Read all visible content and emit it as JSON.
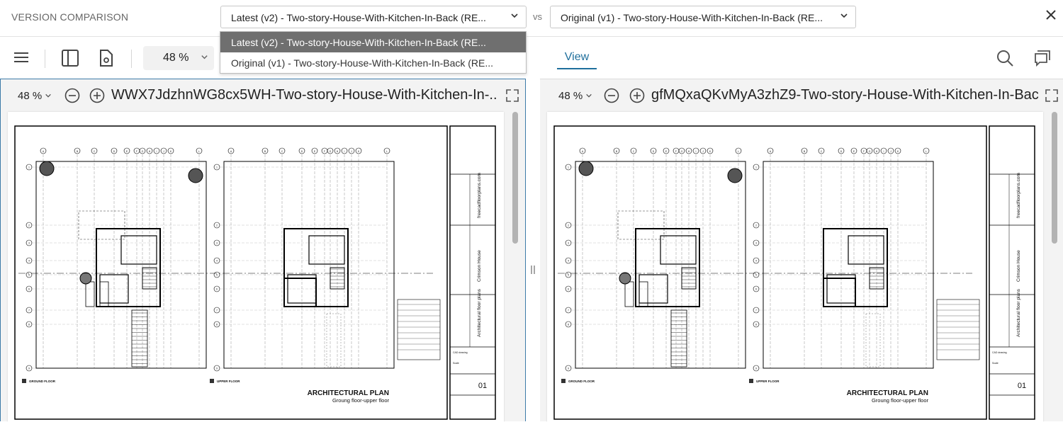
{
  "header": {
    "title": "VERSION COMPARISON",
    "left_version": "Latest (v2) - Two-story-House-With-Kitchen-In-Back (RE...",
    "vs_label": "vs",
    "right_version": "Original (v1) - Two-story-House-With-Kitchen-In-Back (RE...",
    "close_icon": "close-icon"
  },
  "dropdown": {
    "options": [
      "Latest (v2) - Two-story-House-With-Kitchen-In-Back (RE...",
      "Original (v1) - Two-story-House-With-Kitchen-In-Back (RE..."
    ],
    "selected_index": 0
  },
  "toolbar": {
    "zoom": "48 %",
    "view_tab": "View",
    "icons": [
      "menu-icon",
      "panel-icon",
      "document-settings-icon",
      "search-icon",
      "comment-icon"
    ]
  },
  "panels": {
    "left": {
      "zoom": "48 %",
      "file_name": "WWX7JdzhnWG8cx5WH-Two-story-House-With-Kitchen-In-...",
      "scroll_fraction": 0.38
    },
    "right": {
      "zoom": "48 %",
      "file_name": "gfMQxaQKvMyA3zhZ9-Two-story-House-With-Kitchen-In-Bac...",
      "scroll_fraction": 0.38
    }
  },
  "drawing": {
    "sheet_title": "ARCHITECTURAL PLAN",
    "sheet_subtitle": "Groung floor-upper floor",
    "ground_label": "GROUND FLOOR",
    "upper_label": "UPPER FLOOR",
    "sheet_number": "01",
    "site": "freecadfloorplans.com",
    "project": "Crimson House",
    "drawing_name": "Architectural floor plans",
    "cad_label": "CAD drawing",
    "scale_label": "Scale",
    "col_labels": [
      "A",
      "B",
      "C",
      "D",
      "E",
      "F",
      "G",
      "H",
      "I",
      "J",
      "K",
      "L"
    ],
    "row_labels": [
      "1",
      "2",
      "3",
      "4",
      "5",
      "6",
      "7",
      "8",
      "9",
      "10",
      "11",
      "12"
    ]
  },
  "colors": {
    "accent": "#1f6f9c",
    "panel_border": "#3c7aa8",
    "dropdown_selected": "#6f6f6f"
  }
}
